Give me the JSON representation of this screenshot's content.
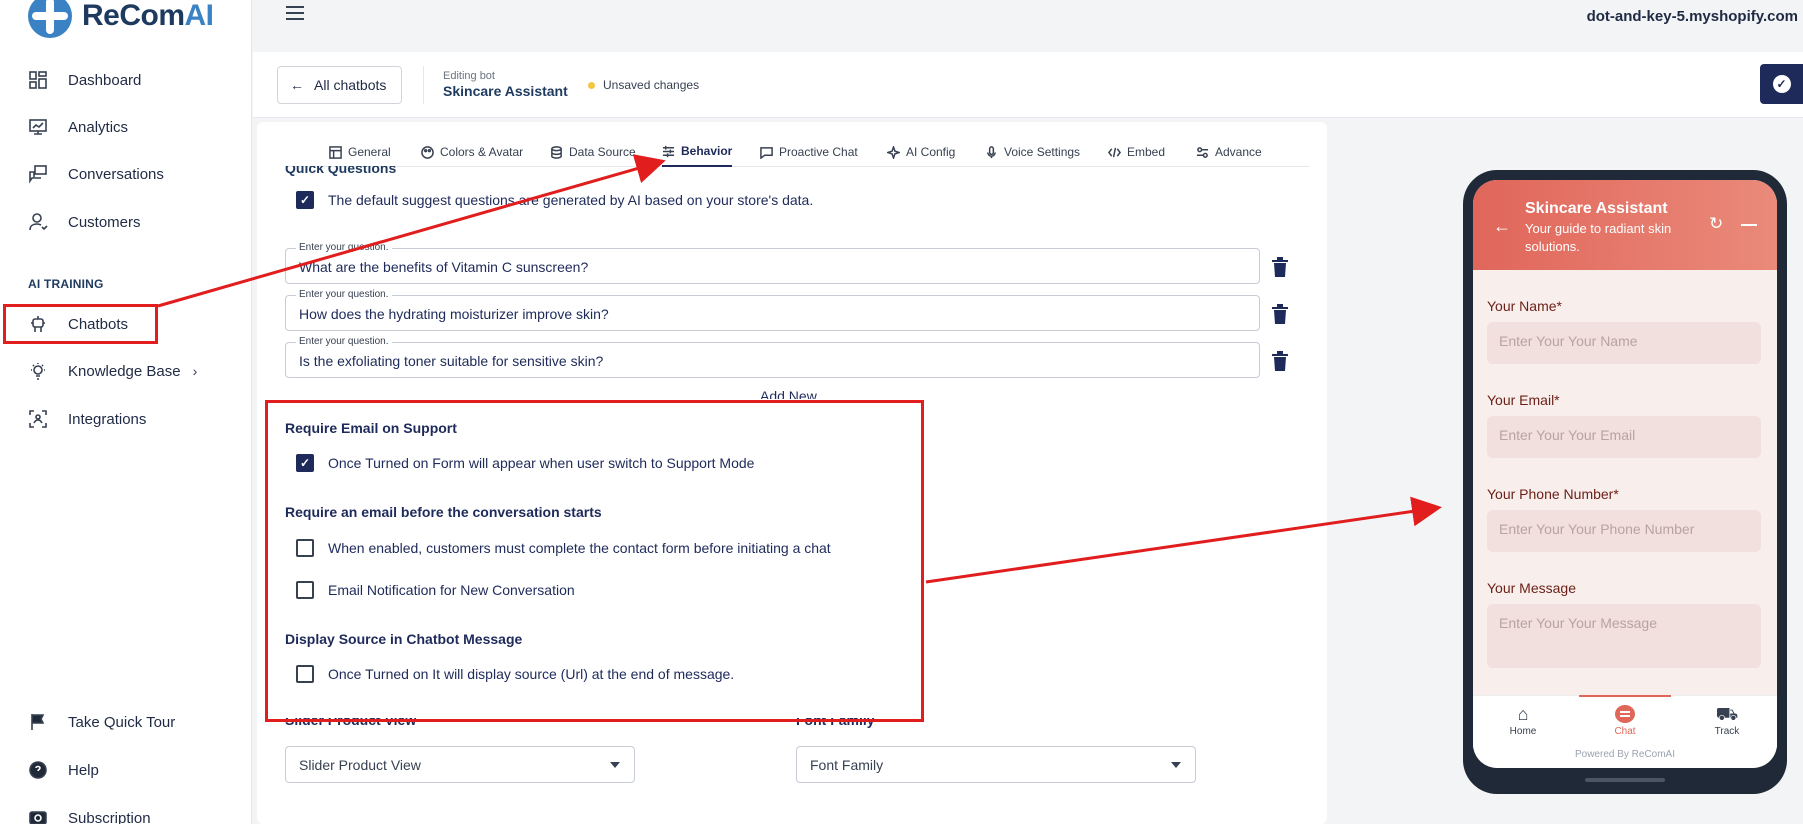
{
  "app": {
    "logo_prefix": "ReCom",
    "logo_suffix": "AI",
    "shop_domain": "dot-and-key-5.myshopify.com"
  },
  "sidebar": {
    "items": [
      {
        "label": "Dashboard",
        "icon": "dashboard-icon"
      },
      {
        "label": "Analytics",
        "icon": "analytics-icon"
      },
      {
        "label": "Conversations",
        "icon": "conversations-icon"
      },
      {
        "label": "Customers",
        "icon": "customers-icon"
      }
    ],
    "section_label": "AI TRAINING",
    "training_items": [
      {
        "label": "Chatbots",
        "icon": "robot-icon"
      },
      {
        "label": "Knowledge Base",
        "icon": "lightbulb-icon",
        "chevron": "›"
      },
      {
        "label": "Integrations",
        "icon": "integrations-icon"
      }
    ],
    "bottom_items": [
      {
        "label": "Take Quick Tour",
        "icon": "flag-icon"
      },
      {
        "label": "Help",
        "icon": "help-icon"
      },
      {
        "label": "Subscription",
        "icon": "subscription-icon"
      }
    ]
  },
  "header": {
    "back_label": "All chatbots",
    "editing_label": "Editing bot",
    "bot_name": "Skincare Assistant",
    "unsaved_label": "Unsaved changes"
  },
  "tabs": [
    {
      "label": "General",
      "active": false
    },
    {
      "label": "Colors & Avatar",
      "active": false
    },
    {
      "label": "Data Source",
      "active": false
    },
    {
      "label": "Behavior",
      "active": true
    },
    {
      "label": "Proactive Chat",
      "active": false
    },
    {
      "label": "AI Config",
      "active": false
    },
    {
      "label": "Voice Settings",
      "active": false
    },
    {
      "label": "Embed",
      "active": false
    },
    {
      "label": "Advance",
      "active": false
    }
  ],
  "quick_questions": {
    "title": "Quick Questions",
    "default_checkbox_label": "The default suggest questions are generated by AI based on your store's data.",
    "field_label": "Enter your question.",
    "questions": [
      "What are the benefits of Vitamin C sunscreen?",
      "How does the hydrating moisturizer improve skin?",
      "Is the exfoliating toner suitable for sensitive skin?"
    ],
    "add_new_label": "Add New"
  },
  "behavior": {
    "support_title": "Require Email on Support",
    "support_checkbox": "Once Turned on Form will appear when user switch to Support Mode",
    "pre_chat_title": "Require an email before the conversation starts",
    "pre_chat_checkbox": "When enabled, customers must complete the contact form before initiating a chat",
    "notify_checkbox": "Email Notification for New Conversation",
    "source_title": "Display Source in Chatbot Message",
    "source_checkbox": "Once Turned on It will display source (Url) at the end of message."
  },
  "lower": {
    "slider_label": "Slider Product View",
    "slider_value": "Slider Product View",
    "font_label": "Font Family",
    "font_value": "Font Family"
  },
  "preview": {
    "title": "Skincare Assistant",
    "subtitle": "Your guide to radiant skin solutions.",
    "fields": [
      {
        "label": "Your Name*",
        "placeholder": "Enter Your Your Name"
      },
      {
        "label": "Your Email*",
        "placeholder": "Enter Your Your Email"
      },
      {
        "label": "Your Phone Number*",
        "placeholder": "Enter Your Your Phone Number"
      },
      {
        "label": "Your Message",
        "placeholder": "Enter Your Your Message"
      }
    ],
    "nav": [
      {
        "label": "Home"
      },
      {
        "label": "Chat"
      },
      {
        "label": "Track"
      }
    ],
    "powered_by": "Powered By ReComAI",
    "accent_color": "#e0665a"
  },
  "colors": {
    "primary": "#1e2a5a",
    "annotation": "#e11d1d",
    "brand": "#3b82c4"
  }
}
